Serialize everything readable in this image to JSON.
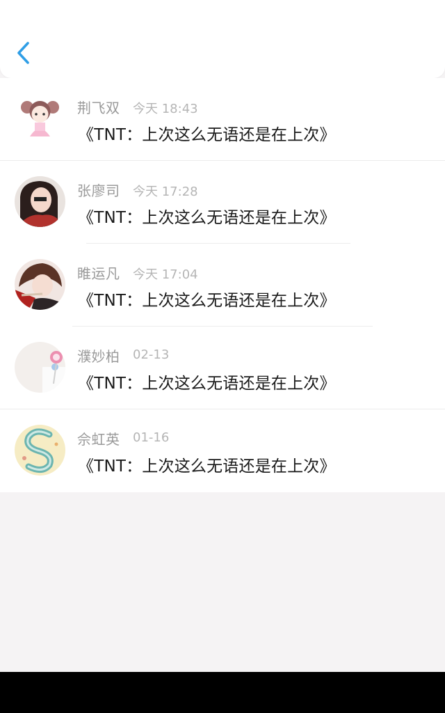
{
  "header": {
    "back_icon": "chevron-left-icon",
    "accent_color": "#2f9ee6"
  },
  "comments": [
    {
      "name": "荆飞双",
      "time": "今天 18:43",
      "message": "《TNT：上次这么无语还是在上次》",
      "avatar_icon": "avatar-anime-girl-icon"
    },
    {
      "name": "张廖司",
      "time": "今天 17:28",
      "message": "《TNT：上次这么无语还是在上次》",
      "avatar_icon": "avatar-girl-photo-icon"
    },
    {
      "name": "睢运凡",
      "time": "今天 17:04",
      "message": "《TNT：上次这么无语还是在上次》",
      "avatar_icon": "avatar-anime-boy-icon"
    },
    {
      "name": "濮妙柏",
      "time": "02-13",
      "message": "《TNT：上次这么无语还是在上次》",
      "avatar_icon": "avatar-lollipop-icon"
    },
    {
      "name": "佘虹英",
      "time": "01-16",
      "message": "《TNT：上次这么无语还是在上次》",
      "avatar_icon": "avatar-letter-s-icon"
    }
  ]
}
